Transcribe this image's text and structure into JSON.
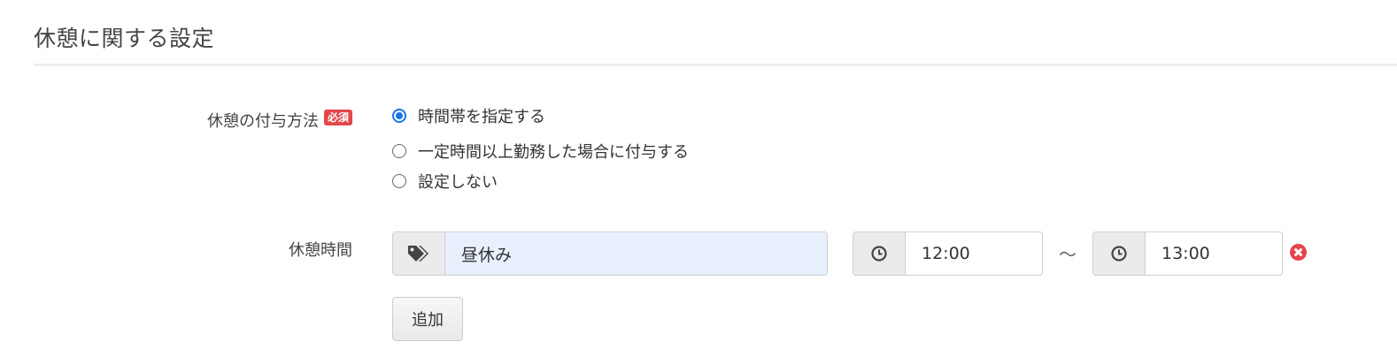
{
  "section": {
    "title": "休憩に関する設定"
  },
  "break_method": {
    "label": "休憩の付与方法",
    "required_badge": "必須",
    "options": [
      {
        "label": "時間帯を指定する",
        "checked": true
      },
      {
        "label": "一定時間以上勤務した場合に付与する",
        "checked": false
      },
      {
        "label": "設定しない",
        "checked": false
      }
    ]
  },
  "break_time": {
    "label": "休憩時間",
    "name_value": "昼休み",
    "start_time": "12:00",
    "separator": "〜",
    "end_time": "13:00",
    "add_button_label": "追加"
  },
  "icons": {
    "name_addon": "tags-icon",
    "time_addon": "clock-icon",
    "remove": "remove-circle-icon"
  },
  "colors": {
    "required_badge": "#e4454a",
    "radio_checked": "#1a73e8",
    "name_input_bg": "#e8f0fe",
    "remove_icon": "#e4454a"
  }
}
